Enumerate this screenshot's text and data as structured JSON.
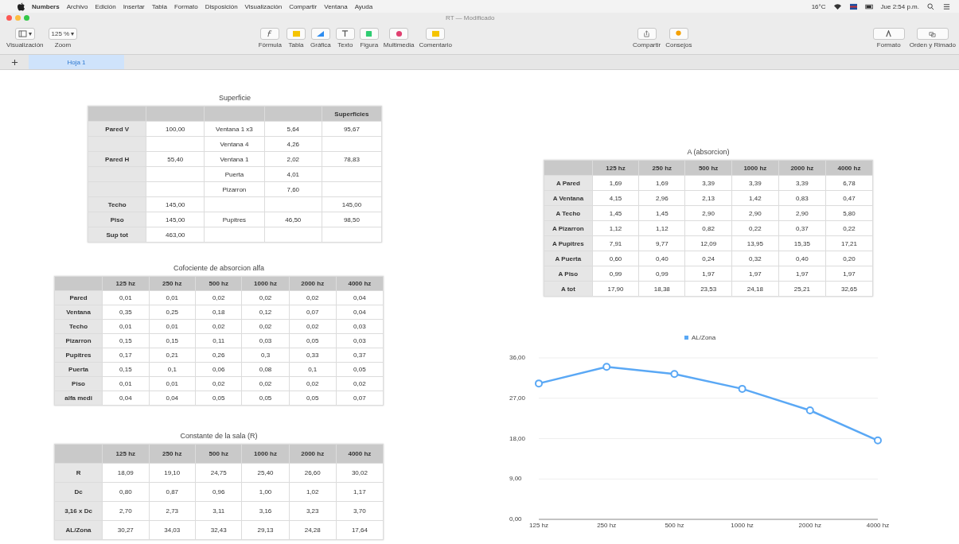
{
  "menu_bar": {
    "app": "Numbers",
    "items": [
      "Archivo",
      "Edición",
      "Insertar",
      "Tabla",
      "Formato",
      "Disposición",
      "Visualización",
      "Compartir",
      "Ventana",
      "Ayuda"
    ],
    "temperature": "16°C",
    "clock": "Jue 2:54 p.m."
  },
  "window": {
    "title": "RT — Modificado"
  },
  "toolbar": {
    "left": [
      {
        "kind": "view",
        "value": "▾",
        "label": "Visualización"
      },
      {
        "kind": "zoom",
        "value": "125 % ▾",
        "label": "Zoom"
      }
    ],
    "middle": [
      {
        "kind": "formula",
        "label": "Fórmula"
      },
      {
        "kind": "table",
        "label": "Tabla"
      },
      {
        "kind": "chart",
        "label": "Gráfica"
      },
      {
        "kind": "text",
        "label": "Texto"
      },
      {
        "kind": "shape",
        "label": "Figura"
      },
      {
        "kind": "media",
        "label": "Multimedia"
      },
      {
        "kind": "comment",
        "label": "Comentario"
      }
    ],
    "right": [
      {
        "kind": "share",
        "label": "Compartir"
      },
      {
        "kind": "tips",
        "label": "Consejos"
      }
    ],
    "far_right": [
      {
        "kind": "format",
        "label": "Formato"
      },
      {
        "kind": "arrange",
        "label": "Orden y Rimado"
      }
    ]
  },
  "sheet_tabs": [
    {
      "label": "Hoja 1",
      "selected": true
    }
  ],
  "tables": [
    {
      "title": "Superficie",
      "columns": [
        "",
        "",
        "",
        "",
        "Superficies"
      ],
      "rows": [
        [
          "Pared V",
          "100,00",
          "Ventana 1 x3",
          "5,64",
          "95,67"
        ],
        [
          "",
          "",
          "Ventana 4",
          "4,26",
          ""
        ],
        [
          "Pared H",
          "55,40",
          "Ventana 1",
          "2,02",
          "78,83"
        ],
        [
          "",
          "",
          "Puerta",
          "4,01",
          ""
        ],
        [
          "",
          "",
          "Pizarron",
          "7,60",
          ""
        ],
        [
          "Techo",
          "145,00",
          "",
          "",
          "145,00"
        ],
        [
          "Piso",
          "145,00",
          "Pupitres",
          "46,50",
          "98,50"
        ],
        [
          "Sup tot",
          "463,00",
          "",
          "",
          ""
        ]
      ]
    },
    {
      "title": "Cofociente de absorcion alfa",
      "columns": [
        "",
        "125 hz",
        "250 hz",
        "500 hz",
        "1000 hz",
        "2000 hz",
        "4000 hz"
      ],
      "rows": [
        [
          "Pared",
          "0,01",
          "0,01",
          "0,02",
          "0,02",
          "0,02",
          "0,04"
        ],
        [
          "Ventana",
          "0,35",
          "0,25",
          "0,18",
          "0,12",
          "0,07",
          "0,04"
        ],
        [
          "Techo",
          "0,01",
          "0,01",
          "0,02",
          "0,02",
          "0,02",
          "0,03"
        ],
        [
          "Pizarron",
          "0,15",
          "0,15",
          "0,11",
          "0,03",
          "0,05",
          "0,03"
        ],
        [
          "Pupitres",
          "0,17",
          "0,21",
          "0,26",
          "0,3",
          "0,33",
          "0,37"
        ],
        [
          "Puerta",
          "0,15",
          "0,1",
          "0,06",
          "0,08",
          "0,1",
          "0,05"
        ],
        [
          "Piso",
          "0,01",
          "0,01",
          "0,02",
          "0,02",
          "0,02",
          "0,02"
        ],
        [
          "alfa medi",
          "0,04",
          "0,04",
          "0,05",
          "0,05",
          "0,05",
          "0,07"
        ]
      ]
    },
    {
      "title": "Constante de la sala (R)",
      "columns": [
        "",
        "125 hz",
        "250 hz",
        "500 hz",
        "1000 hz",
        "2000 hz",
        "4000 hz"
      ],
      "rows": [
        [
          "R",
          "18,09",
          "19,10",
          "24,75",
          "25,40",
          "26,60",
          "30,02"
        ],
        [
          "Dc",
          "0,80",
          "0,87",
          "0,96",
          "1,00",
          "1,02",
          "1,17"
        ],
        [
          "3,16 x Dc",
          "2,70",
          "2,73",
          "3,11",
          "3,16",
          "3,23",
          "3,70"
        ],
        [
          "AL/Zona",
          "30,27",
          "34,03",
          "32,43",
          "29,13",
          "24,28",
          "17,64"
        ]
      ]
    },
    {
      "title": "A (absorcion)",
      "columns": [
        "",
        "125 hz",
        "250 hz",
        "500 hz",
        "1000 hz",
        "2000 hz",
        "4000 hz"
      ],
      "rows": [
        [
          "A Pared",
          "1,69",
          "1,69",
          "3,39",
          "3,39",
          "3,39",
          "6,78"
        ],
        [
          "A Ventana",
          "4,15",
          "2,96",
          "2,13",
          "1,42",
          "0,83",
          "0,47"
        ],
        [
          "A Techo",
          "1,45",
          "1,45",
          "2,90",
          "2,90",
          "2,90",
          "5,80"
        ],
        [
          "A Pizarron",
          "1,12",
          "1,12",
          "0,82",
          "0,22",
          "0,37",
          "0,22"
        ],
        [
          "A Pupitres",
          "7,91",
          "9,77",
          "12,09",
          "13,95",
          "15,35",
          "17,21"
        ],
        [
          "A Puerta",
          "0,60",
          "0,40",
          "0,24",
          "0,32",
          "0,40",
          "0,20"
        ],
        [
          "A Piso",
          "0,99",
          "0,99",
          "1,97",
          "1,97",
          "1,97",
          "1,97"
        ],
        [
          "A tot",
          "17,90",
          "18,38",
          "23,53",
          "24,18",
          "25,21",
          "32,65"
        ]
      ]
    }
  ],
  "chart": {
    "chart_data": {
      "type": "line",
      "grid": true,
      "categories": [
        "125 hz",
        "250 hz",
        "500 hz",
        "1000 hz",
        "2000 hz",
        "4000 hz"
      ],
      "series": [
        {
          "name": "AL/Zona",
          "color": "#5aa8f5",
          "marker": true,
          "values": [
            30.3,
            34.0,
            32.4,
            29.1,
            24.3,
            17.6
          ]
        }
      ],
      "ylim": [
        0,
        36
      ],
      "yticks": [
        {
          "value": 0,
          "label": "0,00"
        },
        {
          "value": 9,
          "label": "9,00"
        },
        {
          "value": 18,
          "label": "18,00"
        },
        {
          "value": 27,
          "label": "27,00"
        },
        {
          "value": 36,
          "label": "36,00"
        }
      ]
    }
  }
}
